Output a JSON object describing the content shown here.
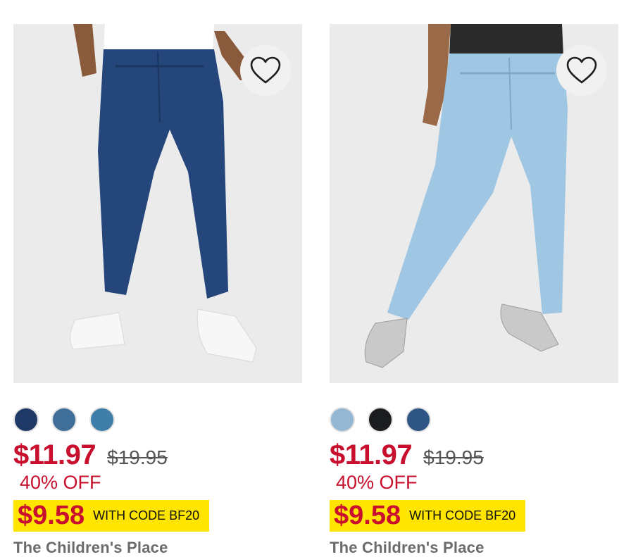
{
  "products": [
    {
      "image_alt": "Dark wash skinny jeans",
      "swatches": [
        "#1f3a66",
        "#3f6f98",
        "#3f7ea8"
      ],
      "price": "$11.97",
      "original_price": "$19.95",
      "discount": "40% OFF",
      "promo_price": "$9.58",
      "promo_code": "WITH CODE BF20",
      "brand": "The Children's Place"
    },
    {
      "image_alt": "Light wash skinny jeans",
      "swatches": [
        "#94b7d3",
        "#1b1c20",
        "#2f5585"
      ],
      "price": "$11.97",
      "original_price": "$19.95",
      "discount": "40% OFF",
      "promo_price": "$9.58",
      "promo_code": "WITH CODE BF20",
      "brand": "The Children's Place"
    }
  ],
  "colors": {
    "sale_red": "#c8102e",
    "promo_yellow": "#ffe500"
  }
}
